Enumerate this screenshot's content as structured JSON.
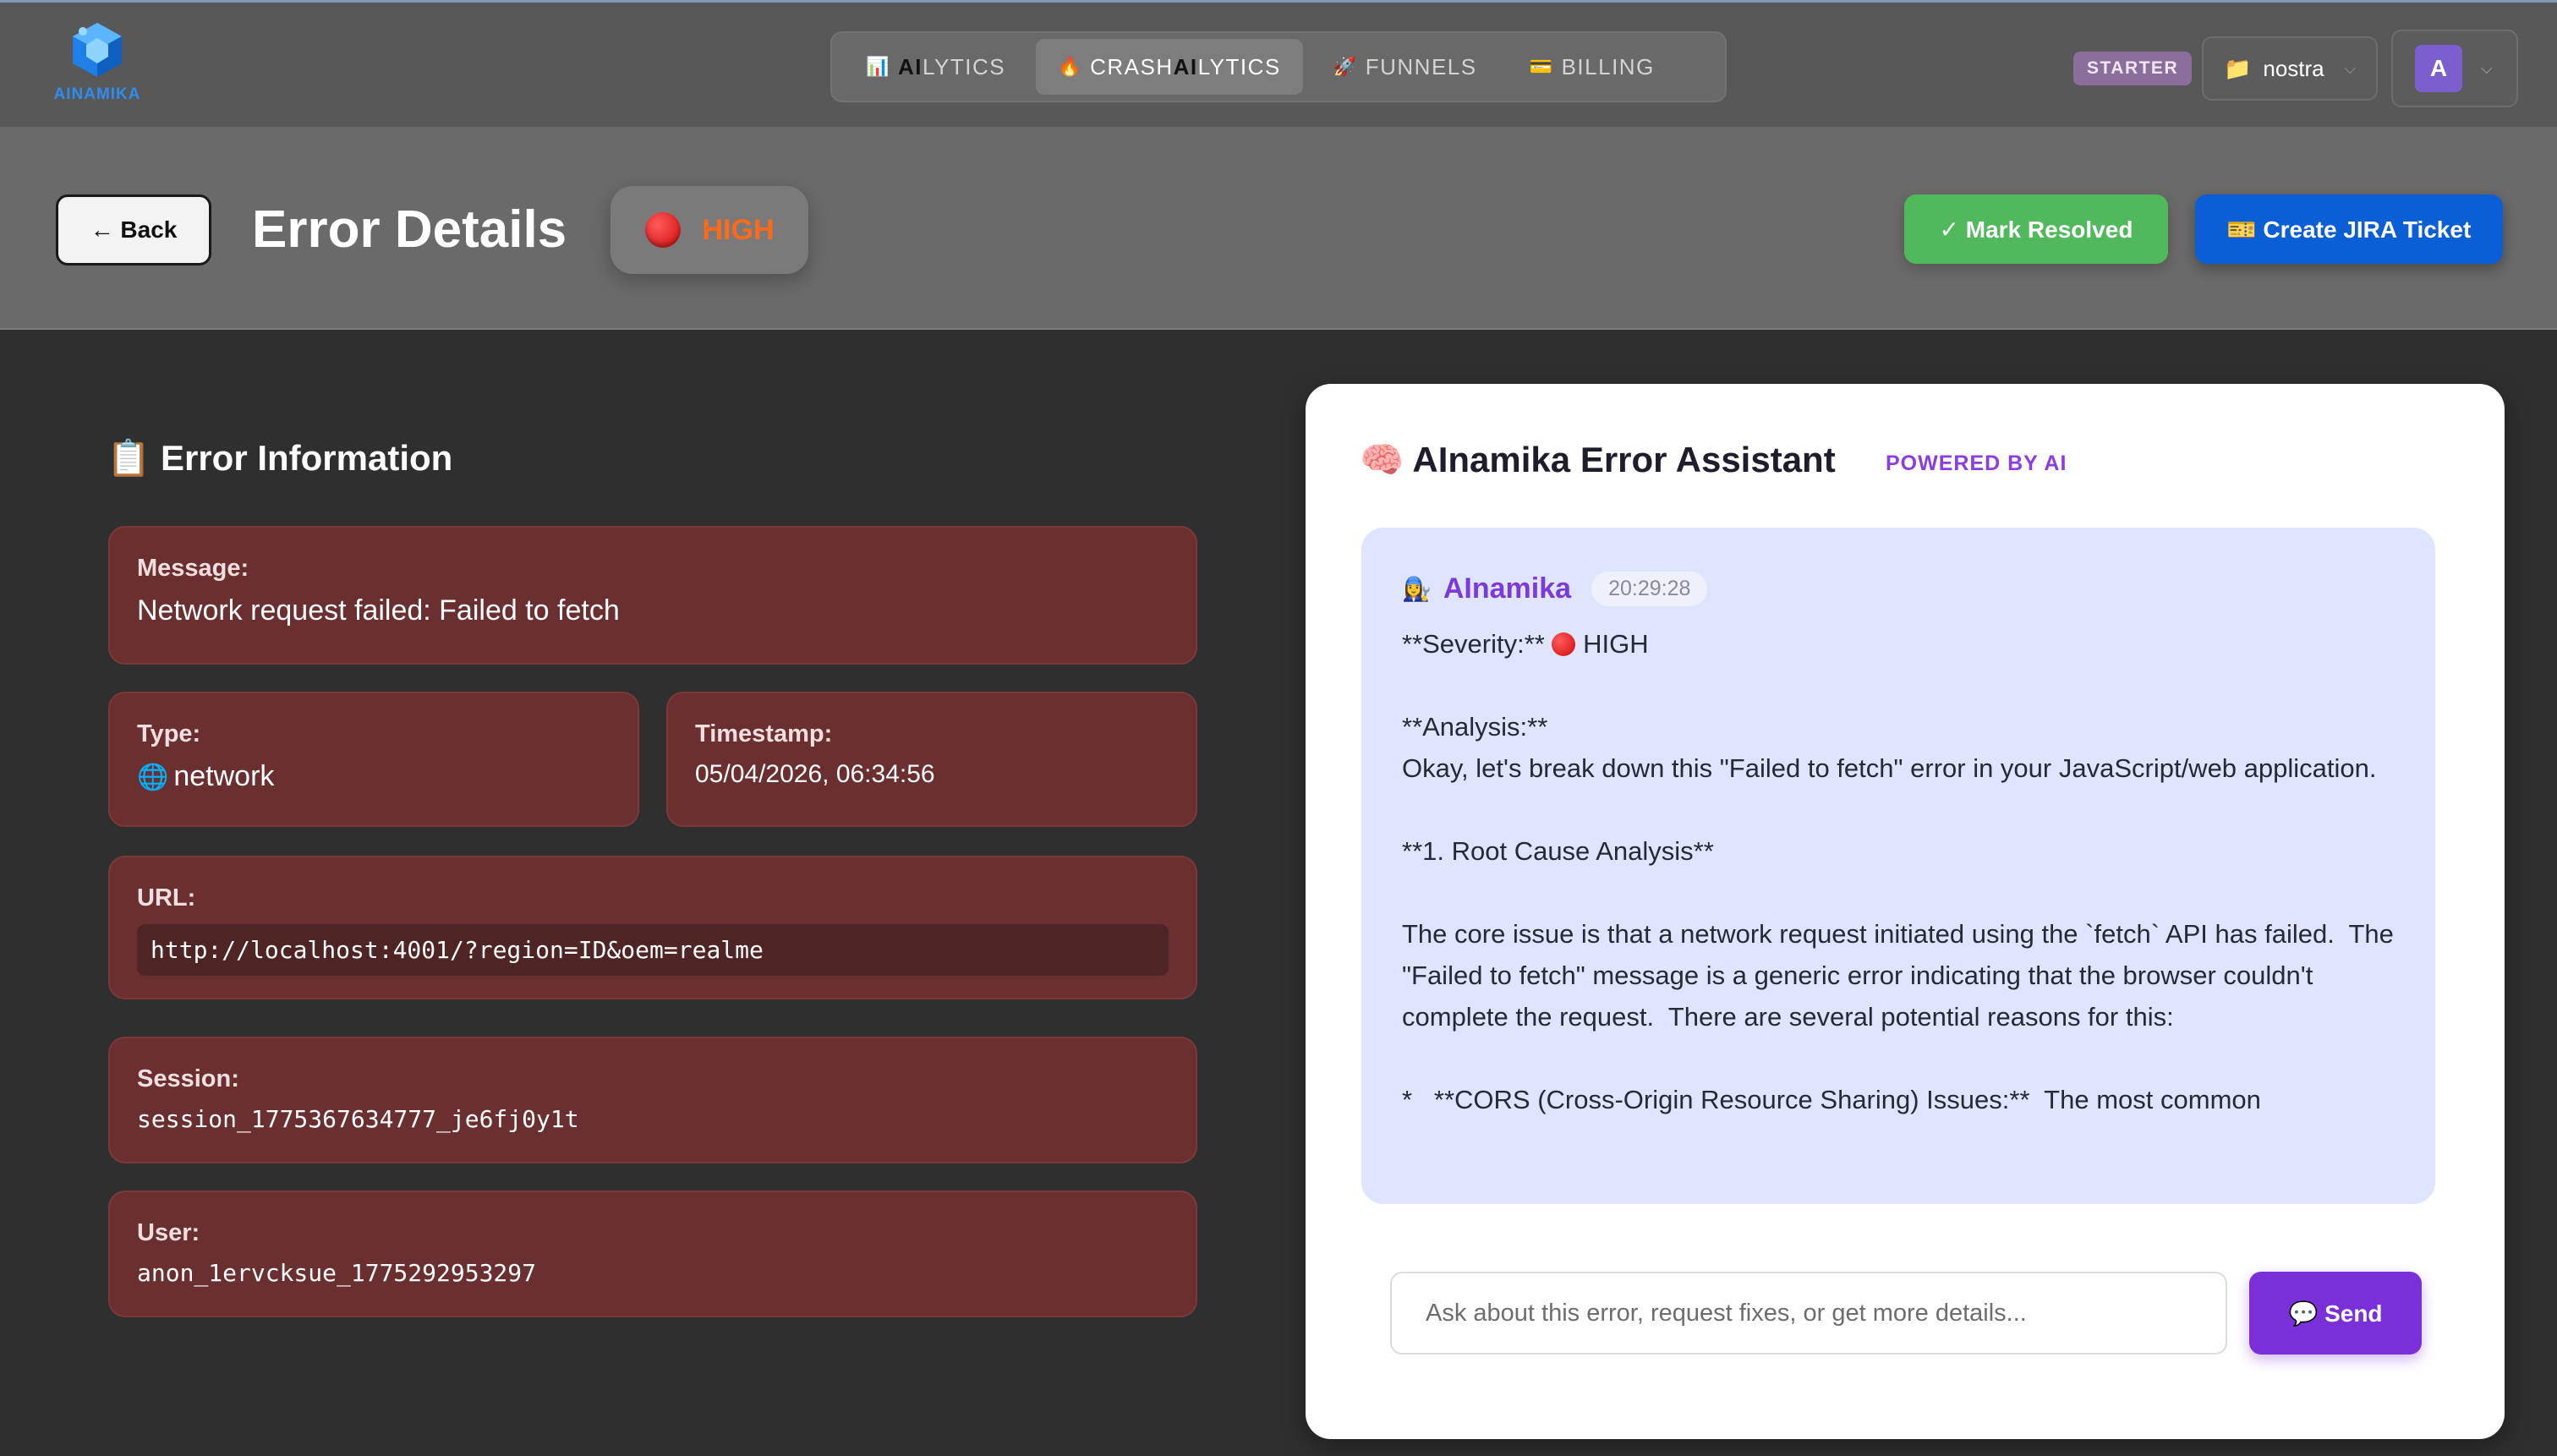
{
  "brand": {
    "logo_text": "AINAMIKA",
    "logo_color": "#2e8df0"
  },
  "nav": {
    "tabs": [
      {
        "icon": "📊",
        "prefix": "",
        "ai": "AI",
        "suffix": "LYTICS",
        "active": false
      },
      {
        "icon": "🔥",
        "prefix": "CRASH",
        "ai": "AI",
        "suffix": "LYTICS",
        "active": true
      },
      {
        "icon": "🚀",
        "prefix": "",
        "ai": "",
        "suffix": "FUNNELS",
        "active": false
      },
      {
        "icon": "💳",
        "prefix": "",
        "ai": "",
        "suffix": "BILLING",
        "active": false
      }
    ],
    "plan_badge": "STARTER",
    "project": {
      "icon": "📁",
      "name": "nostra"
    },
    "user": {
      "avatar_initial": "A"
    }
  },
  "header": {
    "back_label": "← Back",
    "title": "Error Details",
    "severity": {
      "label": "HIGH",
      "color": "#ff6a1a"
    },
    "resolve_label": "✓ Mark Resolved",
    "jira_label": "🎫 Create JIRA Ticket"
  },
  "error_info": {
    "section_title": "📋 Error Information",
    "message": {
      "label": "Message:",
      "value": "Network request failed: Failed to fetch"
    },
    "type": {
      "label": "Type:",
      "icon": "🌐",
      "value": "network"
    },
    "timestamp": {
      "label": "Timestamp:",
      "value": "05/04/2026, 06:34:56"
    },
    "url": {
      "label": "URL:",
      "value": "http://localhost:4001/?region=ID&oem=realme"
    },
    "session": {
      "label": "Session:",
      "value": "session_1775367634777_je6fj0y1t"
    },
    "user": {
      "label": "User:",
      "value": "anon_1ervcksue_1775292953297"
    }
  },
  "assistant": {
    "title": "🧠 AInamika Error Assistant",
    "powered_by": "POWERED BY AI",
    "message": {
      "author_icon": "👩‍🔧",
      "author": "AInamika",
      "time": "20:29:28",
      "severity_line_prefix": "**Severity:** ",
      "severity_line_suffix": " HIGH",
      "body": "**Analysis:**\nOkay, let's break down this \"Failed to fetch\" error in your JavaScript/web application.\n\n**1. Root Cause Analysis**\n\nThe core issue is that a network request initiated using the `fetch` API has failed.  The \"Failed to fetch\" message is a generic error indicating that the browser couldn't complete the request.  There are several potential reasons for this:\n\n*   **CORS (Cross-Origin Resource Sharing) Issues:**  The most common"
    },
    "input_placeholder": "Ask about this error, request fixes, or get more details...",
    "send_label": "💬 Send"
  }
}
